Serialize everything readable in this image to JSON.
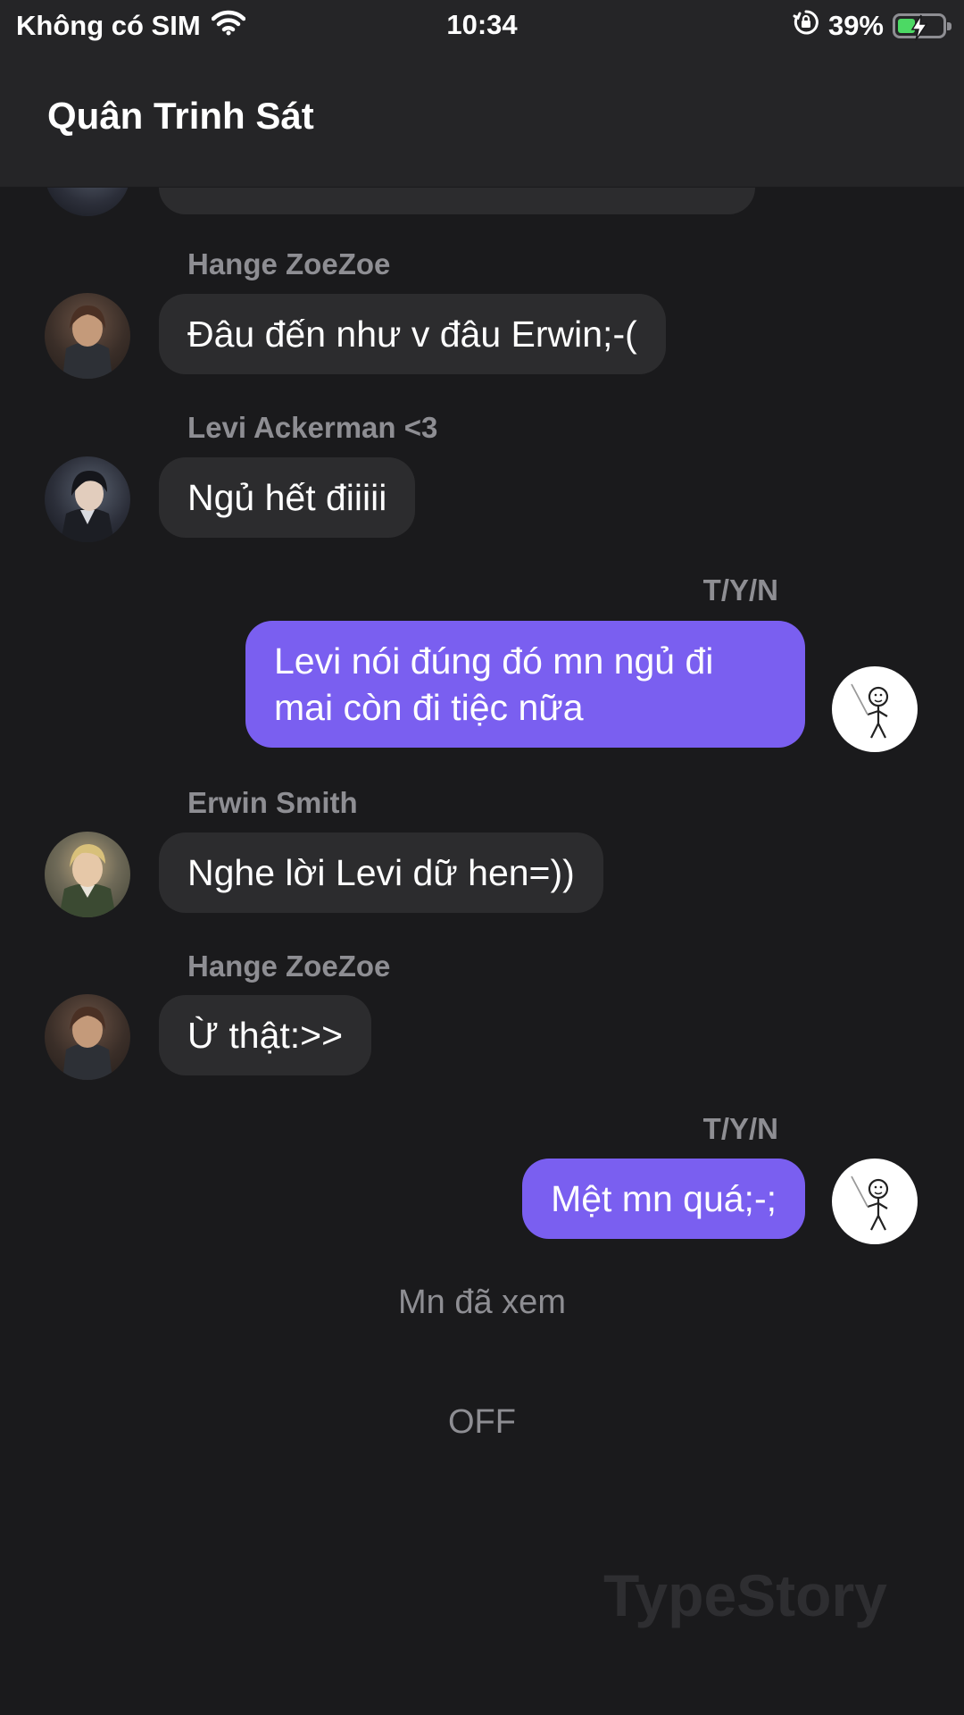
{
  "status_bar": {
    "carrier": "Không có SIM",
    "time": "10:34",
    "battery_percent": "39%",
    "battery_level": 0.39,
    "icons": [
      "wifi-icon",
      "rotation-lock-icon",
      "battery-icon",
      "charging-bolt-icon"
    ]
  },
  "header": {
    "title": "Quân Trinh Sát"
  },
  "messages": [
    {
      "sender": "Hange ZoeZoe",
      "text": "Đâu đến như v đâu Erwin;-(",
      "direction": "incoming"
    },
    {
      "sender": "Levi Ackerman <3",
      "text": "Ngủ hết điiiii",
      "direction": "incoming"
    },
    {
      "sender": "T/Y/N",
      "line1": "Levi nói đúng đó mn ngủ đi",
      "line2": "mai còn đi tiệc nữa",
      "direction": "outgoing"
    },
    {
      "sender": "Erwin Smith",
      "text": "Nghe lời Levi dữ hen=))",
      "direction": "incoming"
    },
    {
      "sender": "Hange ZoeZoe",
      "text": "Ừ thật:>>",
      "direction": "incoming"
    },
    {
      "sender": "T/Y/N",
      "text": "Mệt mn quá;-;",
      "direction": "outgoing"
    }
  ],
  "seen_status": "Mn đã xem",
  "end_status": "OFF",
  "watermark": "TypeStory",
  "colors": {
    "background": "#1a1a1c",
    "header": "#252527",
    "incoming_bubble": "#2c2c2e",
    "outgoing_bubble": "#7a5ff0",
    "muted_text": "#8e8e93",
    "battery": "#4cd964"
  }
}
